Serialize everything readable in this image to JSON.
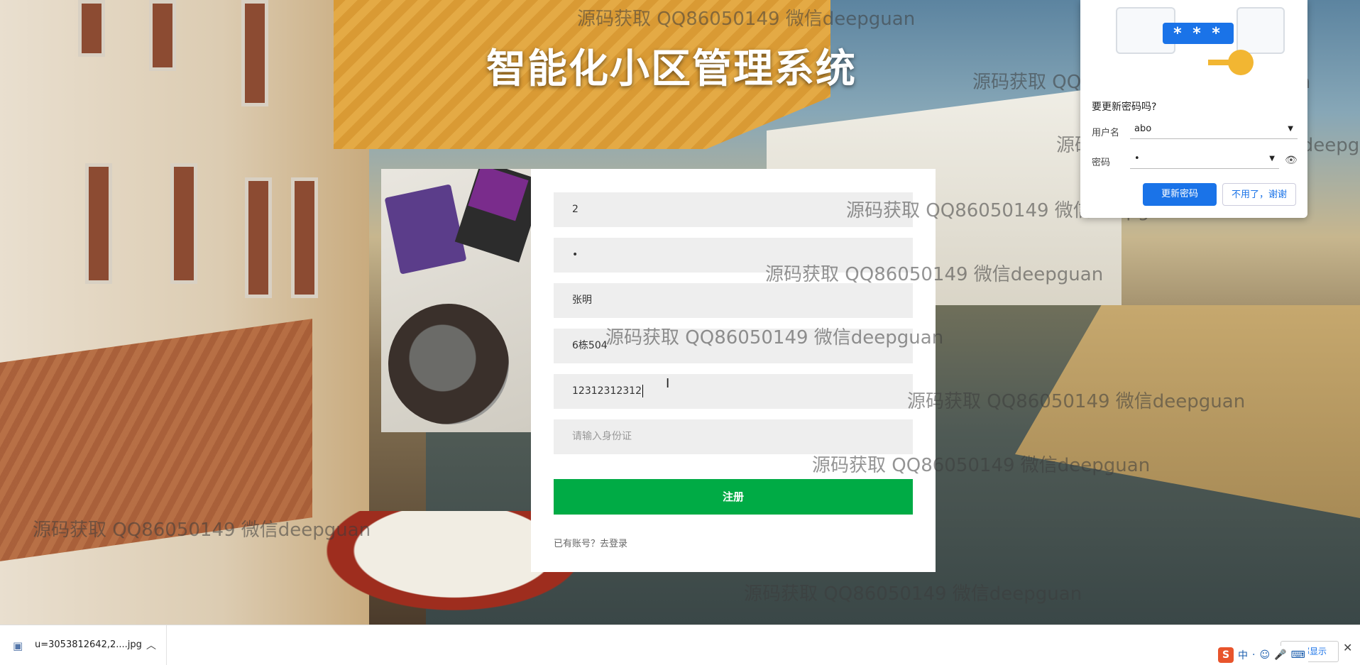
{
  "page": {
    "title": "智能化小区管理系统"
  },
  "register_form": {
    "fields": [
      {
        "value": "2",
        "placeholder": ""
      },
      {
        "value": "•",
        "placeholder": ""
      },
      {
        "value": "张明",
        "placeholder": ""
      },
      {
        "value": "6栋504",
        "placeholder": ""
      },
      {
        "value": "12312312312",
        "placeholder": ""
      },
      {
        "value": "",
        "placeholder": "请输入身份证"
      }
    ],
    "submit_label": "注册",
    "login_link": "已有账号？去登录"
  },
  "watermark_text": "源码获取 QQ86050149 微信deepguan",
  "password_popup": {
    "question": "要更新密码吗?",
    "username_label": "用户名",
    "username_value": "abo",
    "password_label": "密码",
    "password_value": "•",
    "update_button": "更新密码",
    "decline_button": "不用了，谢谢",
    "masked_preview": "* * *"
  },
  "download_bar": {
    "file_name": "u=3053812642,2....jpg",
    "show_all": "全部显示"
  },
  "ime": {
    "logo": "S",
    "label": "中"
  },
  "colors": {
    "primary_green": "#00ab45",
    "chrome_blue": "#1a73e8"
  }
}
